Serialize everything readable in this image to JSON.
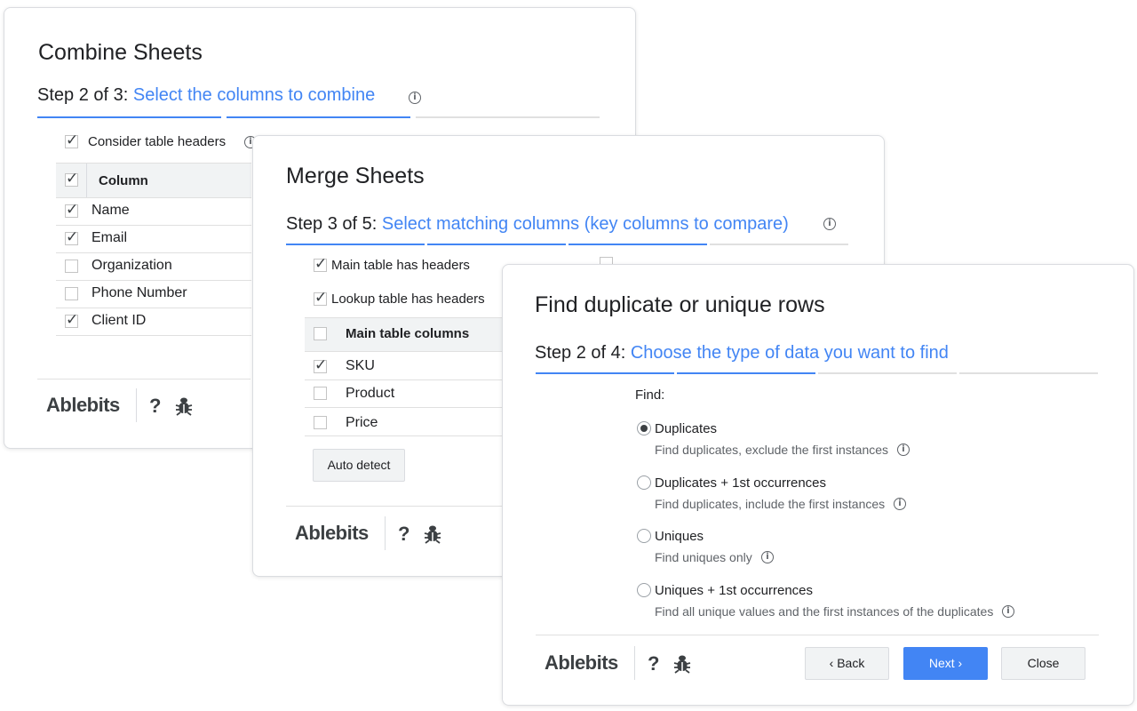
{
  "combine": {
    "title": "Combine Sheets",
    "step_lead": "Step 2 of 3: ",
    "step_text": "Select the columns to combine",
    "consider_headers": "Consider table headers",
    "column_header": "Column",
    "rows": [
      {
        "label": "Name",
        "checked": true
      },
      {
        "label": "Email",
        "checked": true
      },
      {
        "label": "Organization",
        "checked": false
      },
      {
        "label": "Phone Number",
        "checked": false
      },
      {
        "label": "Client ID",
        "checked": true
      }
    ],
    "logo": "Ablebits",
    "help": "?"
  },
  "merge": {
    "title": "Merge Sheets",
    "step_lead": "Step 3 of 5: ",
    "step_text": "Select matching columns (key columns to compare)",
    "main_headers": "Main table has headers",
    "lookup_headers": "Lookup table has headers",
    "column_header": "Main table columns",
    "rows": [
      {
        "label": "SKU",
        "checked": true
      },
      {
        "label": "Product",
        "checked": false
      },
      {
        "label": "Price",
        "checked": false
      }
    ],
    "auto_detect": "Auto detect",
    "logo": "Ablebits",
    "help": "?"
  },
  "find": {
    "title": "Find duplicate or unique rows",
    "step_lead": "Step 2 of 4: ",
    "step_text": "Choose the type of data you want to find",
    "find_label": "Find:",
    "options": [
      {
        "label": "Duplicates",
        "desc": "Find duplicates, exclude the first instances",
        "selected": true
      },
      {
        "label": "Duplicates + 1st occurrences",
        "desc": "Find duplicates, include the first instances",
        "selected": false
      },
      {
        "label": "Uniques",
        "desc": "Find uniques only",
        "selected": false
      },
      {
        "label": "Uniques + 1st occurrences",
        "desc": "Find all unique values and the first instances of the duplicates",
        "selected": false
      }
    ],
    "logo": "Ablebits",
    "help": "?",
    "back": "‹ Back",
    "next": "Next ›",
    "close": "Close"
  },
  "colors": {
    "accent": "#4285f4",
    "text": "#202124",
    "muted": "#5f6368",
    "divider": "#e0e0e0"
  },
  "icons": {
    "info": "info-circle-icon",
    "help": "question-mark-icon",
    "bug": "bug-icon",
    "check": "checkmark-icon"
  }
}
